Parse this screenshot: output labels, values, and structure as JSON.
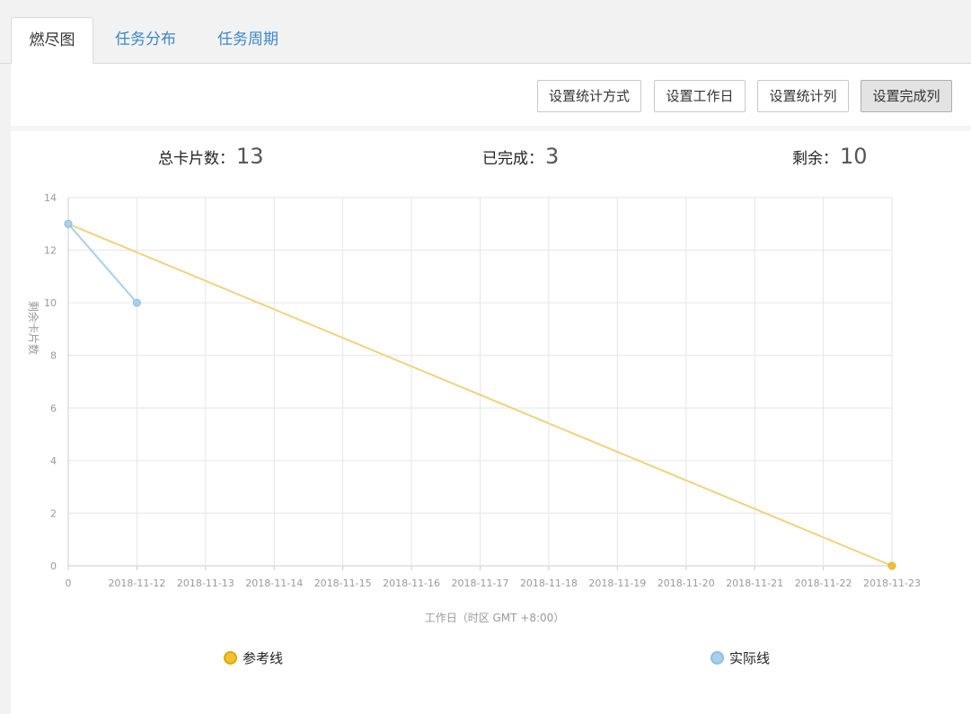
{
  "tabs": [
    {
      "label": "燃尽图",
      "active": true
    },
    {
      "label": "任务分布",
      "active": false
    },
    {
      "label": "任务周期",
      "active": false
    }
  ],
  "toolbar": {
    "stat_method": "设置统计方式",
    "workday": "设置工作日",
    "stat_columns": "设置统计列",
    "done_column": "设置完成列"
  },
  "stats": {
    "total_label": "总卡片数：",
    "total_value": "13",
    "done_label": "已完成：",
    "done_value": "3",
    "remaining_label": "剩余：",
    "remaining_value": "10"
  },
  "colors": {
    "reference": "#f0d27e",
    "reference_legend": "#f2c037",
    "actual": "#a9cfee",
    "actual_legend": "#a9cfee",
    "grid": "#e6e6e6",
    "axis": "#cccccc",
    "tick_text": "#999999",
    "tab_link": "#3a87c8"
  },
  "chart_data": {
    "type": "line",
    "categories": [
      "0",
      "2018-11-12",
      "2018-11-13",
      "2018-11-14",
      "2018-11-15",
      "2018-11-16",
      "2018-11-17",
      "2018-11-18",
      "2018-11-19",
      "2018-11-20",
      "2018-11-21",
      "2018-11-22",
      "2018-11-23"
    ],
    "ylim": [
      0,
      14
    ],
    "yticks": [
      "0",
      "2",
      "4",
      "6",
      "8",
      "10",
      "12",
      "14"
    ],
    "xlabel": "工作日（时区 GMT +8:00）",
    "ylabel": "剩余卡片数",
    "grid": true,
    "legend_position": "bottom",
    "series": [
      {
        "name": "参考线",
        "points": [
          {
            "x": "0",
            "y": 13
          },
          {
            "x": "2018-11-23",
            "y": 0
          }
        ]
      },
      {
        "name": "实际线",
        "points": [
          {
            "x": "0",
            "y": 13
          },
          {
            "x": "2018-11-12",
            "y": 10
          }
        ]
      }
    ]
  }
}
